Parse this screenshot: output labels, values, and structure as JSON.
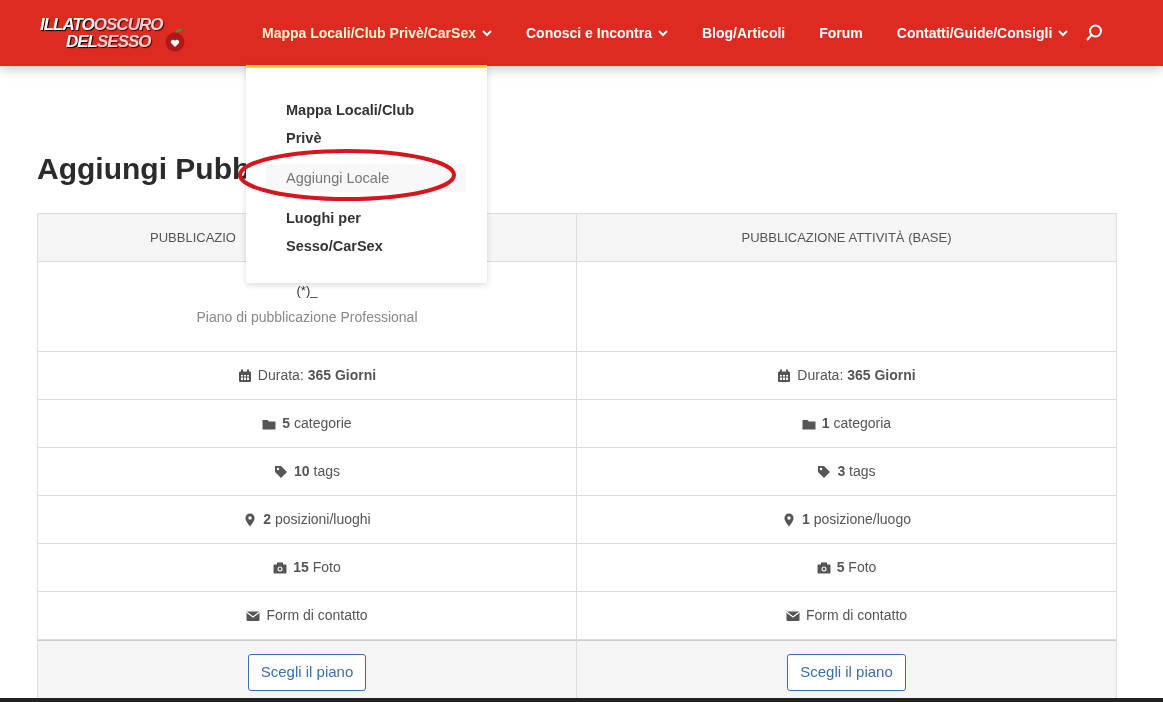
{
  "logo": {
    "lines": [
      [
        "IL",
        "LATO",
        "OSCURO"
      ],
      [
        "DEL",
        "SESSO"
      ]
    ]
  },
  "nav": [
    {
      "label": "Mappa Locali/Club Privè/CarSex",
      "dropdown": true,
      "expanded": true
    },
    {
      "label": "Conosci e Incontra",
      "dropdown": true,
      "expanded": false
    },
    {
      "label": "Blog/Articoli",
      "dropdown": false,
      "expanded": false
    },
    {
      "label": "Forum",
      "dropdown": false,
      "expanded": false
    },
    {
      "label": "Contatti/Guide/Consigli",
      "dropdown": true,
      "expanded": false
    }
  ],
  "dropdown": [
    {
      "label": "Mappa Locali/Club Privè",
      "selected": false
    },
    {
      "label": "Aggiungi Locale",
      "selected": true
    },
    {
      "label": "Luoghi per Sesso/CarSex",
      "selected": false
    }
  ],
  "heading": "Aggiungi Pubb",
  "plans": [
    {
      "title": "PUBBLICAZIO",
      "price": "(*)_",
      "description": "Piano di pubblicazione Professional",
      "features": [
        {
          "kind": "calendar",
          "text": "Durata: **365 Giorni**"
        },
        {
          "kind": "folder",
          "text": "**5** categorie"
        },
        {
          "kind": "tag",
          "text": "**10** tags"
        },
        {
          "kind": "pin",
          "text": "**2** posizioni/luoghi"
        },
        {
          "kind": "camera",
          "text": "**15** Foto"
        },
        {
          "kind": "envelope",
          "text": "Form di contatto"
        }
      ],
      "button": "Scegli il piano"
    },
    {
      "title": "PUBBLICAZIONE ATTIVITÀ (BASE)",
      "features": [
        {
          "kind": "calendar",
          "text": "Durata: **365 Giorni**"
        },
        {
          "kind": "folder",
          "text": "**1** categoria"
        },
        {
          "kind": "tag",
          "text": "**3** tags"
        },
        {
          "kind": "pin",
          "text": "**1** posizione/luogo"
        },
        {
          "kind": "camera",
          "text": "**5** Foto"
        },
        {
          "kind": "envelope",
          "text": "Form di contatto"
        }
      ],
      "button": "Scegli il piano"
    }
  ]
}
